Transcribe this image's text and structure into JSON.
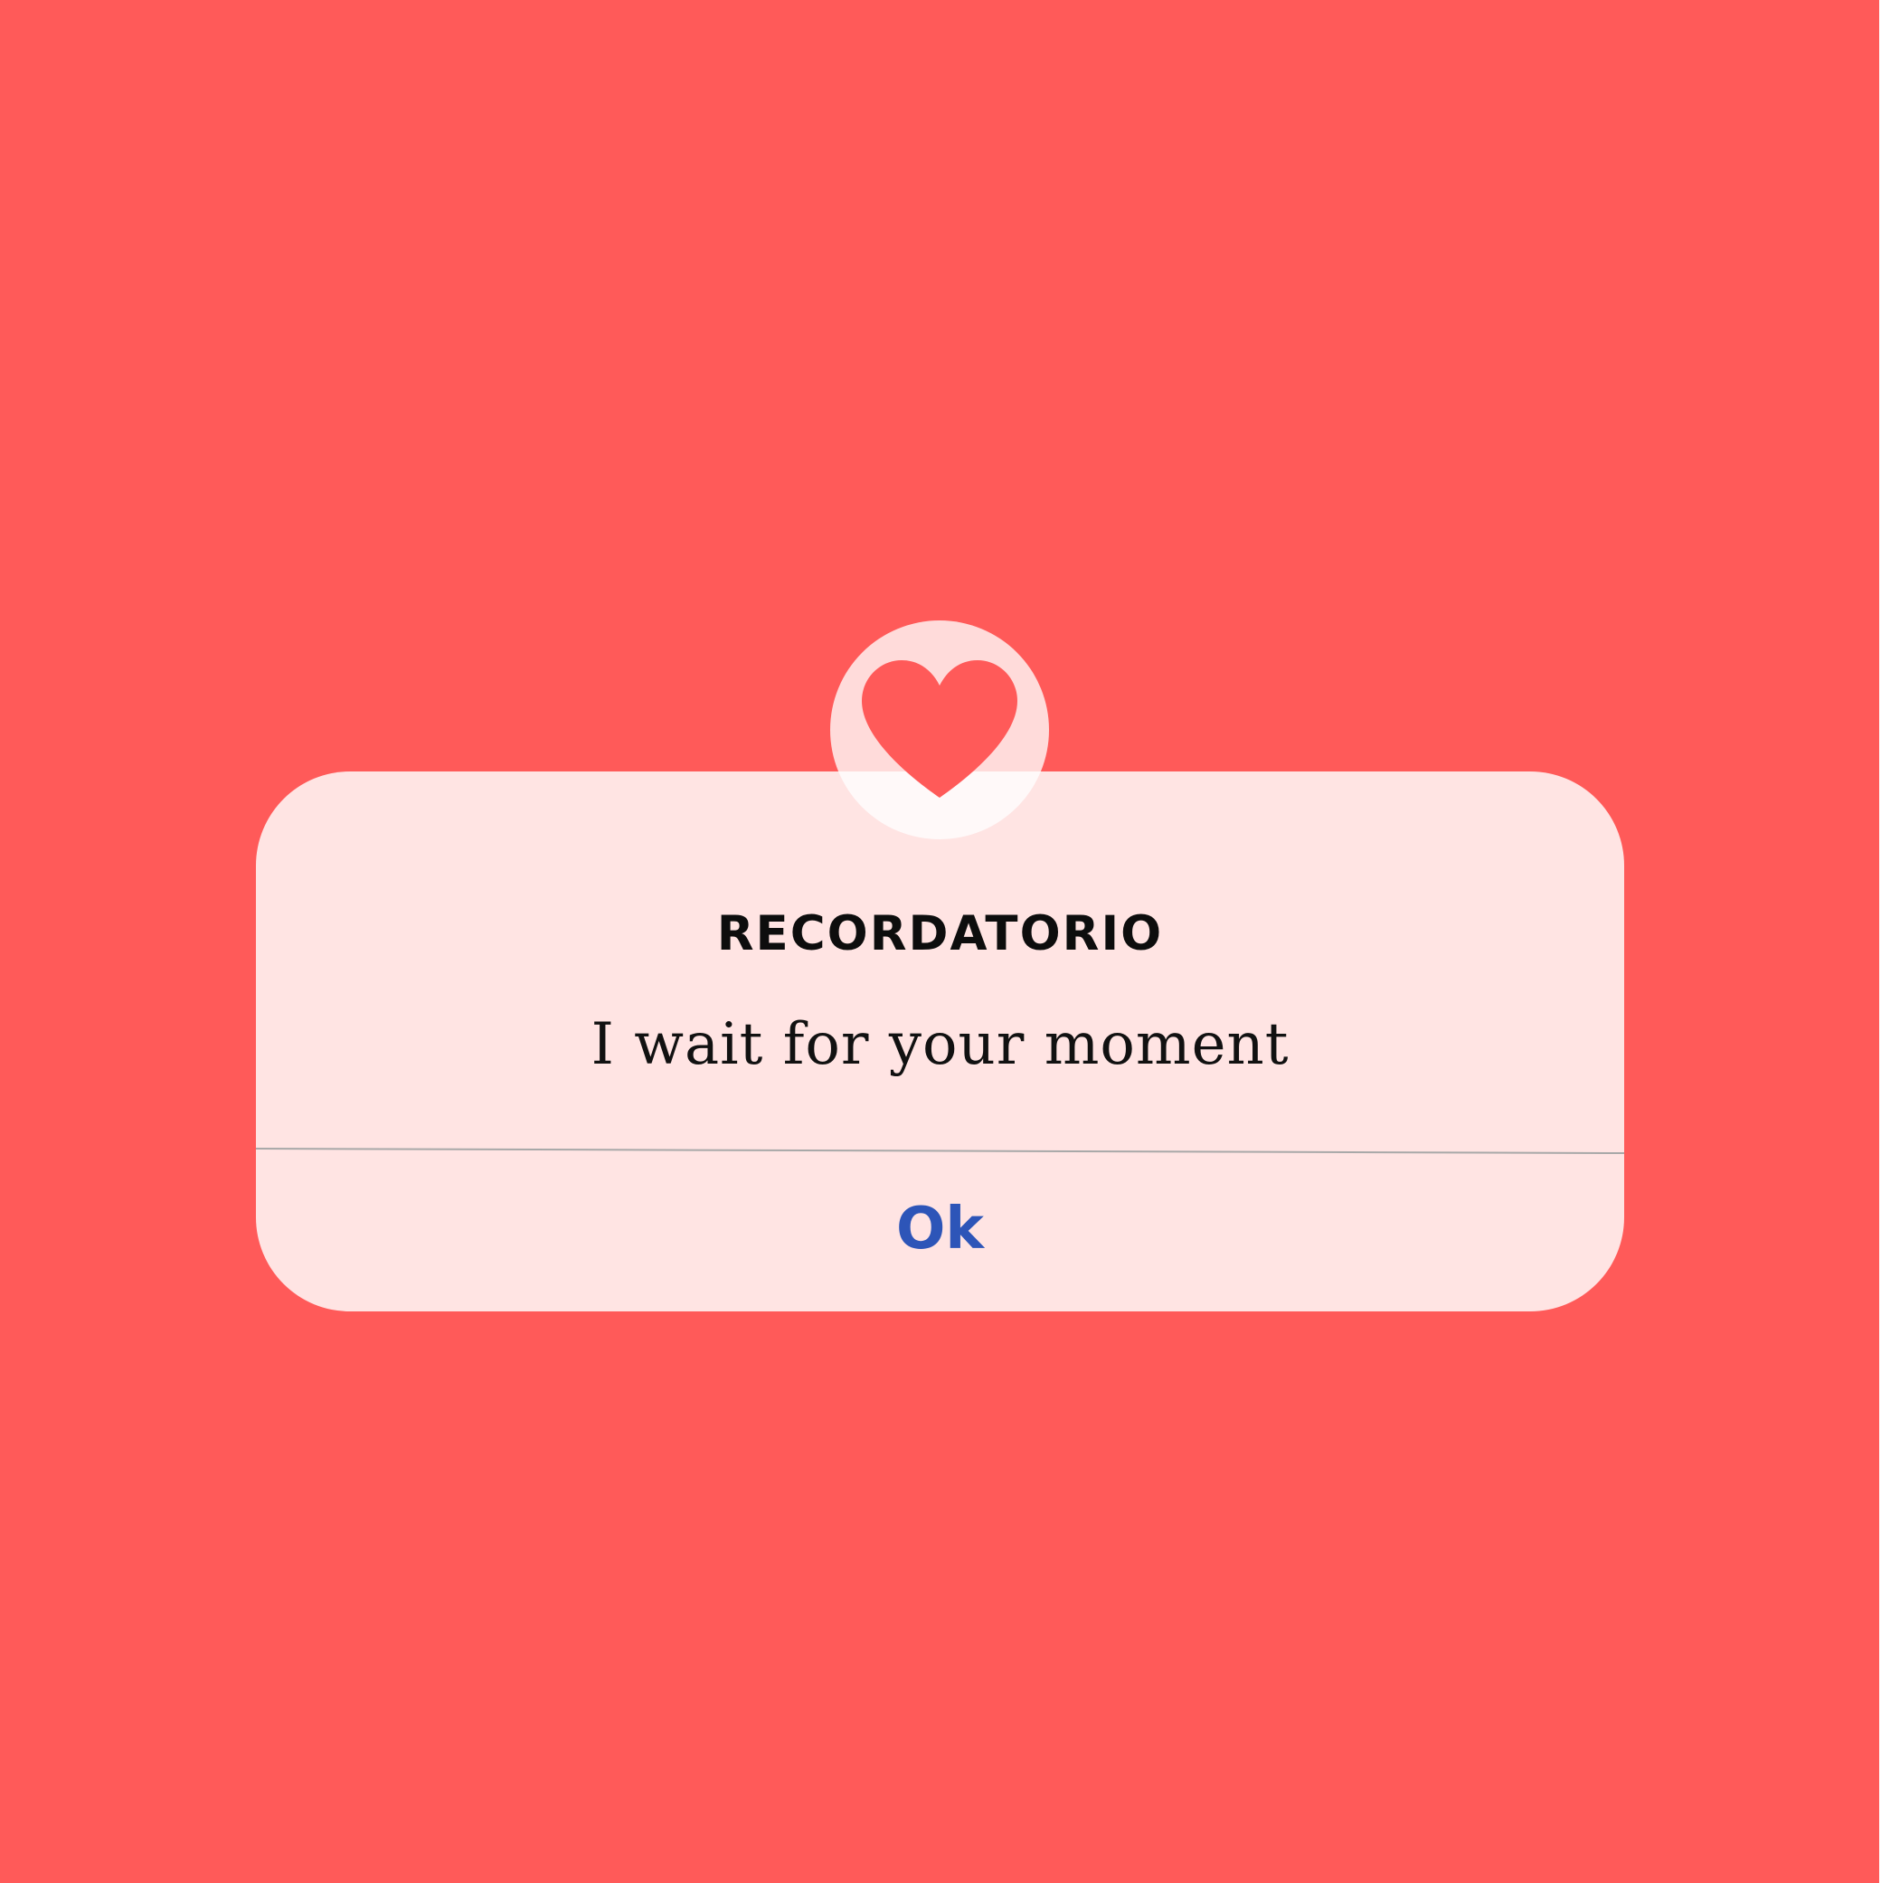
{
  "colors": {
    "background": "#ff5a59",
    "dialog": "#ffe4e3",
    "heart": "#ff5a59",
    "button_text": "#2d55b8",
    "divider": "#a8a8a8"
  },
  "dialog": {
    "icon": "heart-icon",
    "title": "RECORDATORIO",
    "message": "I wait for your moment",
    "button_label": "Ok"
  }
}
